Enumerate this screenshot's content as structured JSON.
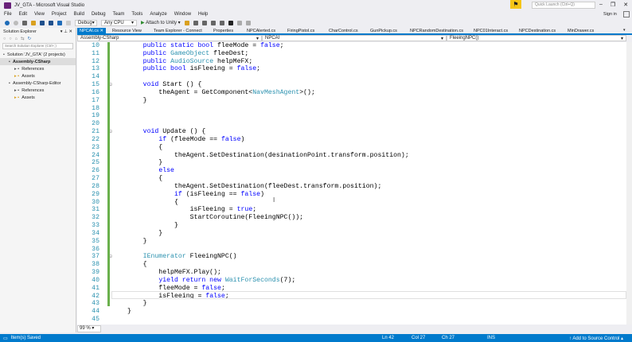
{
  "window": {
    "title": "JV_GTA - Microsoft Visual Studio",
    "quick_launch_placeholder": "Quick Launch (Ctrl+Q)",
    "sign_in": "Sign in"
  },
  "menu": [
    "File",
    "Edit",
    "View",
    "Project",
    "Build",
    "Debug",
    "Team",
    "Tools",
    "Analyze",
    "Window",
    "Help"
  ],
  "toolbar": {
    "config": "Debug",
    "platform": "Any CPU",
    "attach": "Attach to Unity"
  },
  "solution_explorer": {
    "title": "Solution Explorer",
    "search_placeholder": "Search Solution Explorer (Ctrl+;)",
    "items": [
      {
        "label": "Solution 'JV_GTA' (2 projects)",
        "indent": 0
      },
      {
        "label": "Assembly-CSharp",
        "indent": 1
      },
      {
        "label": "References",
        "indent": 2
      },
      {
        "label": "Assets",
        "indent": 2
      },
      {
        "label": "Assembly-CSharp-Editor",
        "indent": 1
      },
      {
        "label": "References",
        "indent": 2
      },
      {
        "label": "Assets",
        "indent": 2
      }
    ]
  },
  "tabs": [
    "NPCAI.cs",
    "Resource View",
    "Team Explorer - Connect",
    "Properties",
    "NPCAlerted.cs",
    "FiringPistol.cs",
    "CharControl.cs",
    "GunPickup.cs",
    "NPCRandomDestination.cs",
    "NPC01Interact.cs",
    "NPCDestination.cs",
    "MinDrawer.cs"
  ],
  "navbar": {
    "project": "Assembly-CSharp",
    "class": "NPCAI",
    "member": "FleeingNPC()"
  },
  "code": [
    {
      "n": "10",
      "t": [
        [
          "    ",
          "pl"
        ],
        [
          "public static bool ",
          "kw"
        ],
        [
          "fleeMode = ",
          "pl"
        ],
        [
          "false",
          "kw"
        ],
        [
          ";",
          "pl"
        ]
      ]
    },
    {
      "n": "11",
      "t": [
        [
          "    ",
          "pl"
        ],
        [
          "public ",
          "kw"
        ],
        [
          "GameObject ",
          "ty"
        ],
        [
          "fleeDest;",
          "pl"
        ]
      ]
    },
    {
      "n": "12",
      "t": [
        [
          "    ",
          "pl"
        ],
        [
          "public ",
          "kw"
        ],
        [
          "AudioSource ",
          "ty"
        ],
        [
          "helpMeFX;",
          "pl"
        ]
      ]
    },
    {
      "n": "13",
      "t": [
        [
          "    ",
          "pl"
        ],
        [
          "public bool ",
          "kw"
        ],
        [
          "isFleeing = ",
          "pl"
        ],
        [
          "false",
          "kw"
        ],
        [
          ";",
          "pl"
        ]
      ]
    },
    {
      "n": "14",
      "t": []
    },
    {
      "n": "15",
      "t": [
        [
          "    ",
          "pl"
        ],
        [
          "void ",
          "kw"
        ],
        [
          "Start () {",
          "pl"
        ]
      ]
    },
    {
      "n": "16",
      "t": [
        [
          "        theAgent = GetComponent<",
          "pl"
        ],
        [
          "NavMeshAgent",
          "ty"
        ],
        [
          ">();",
          "pl"
        ]
      ]
    },
    {
      "n": "17",
      "t": [
        [
          "    }",
          "pl"
        ]
      ]
    },
    {
      "n": "18",
      "t": []
    },
    {
      "n": "19",
      "t": []
    },
    {
      "n": "20",
      "t": []
    },
    {
      "n": "21",
      "t": [
        [
          "    ",
          "pl"
        ],
        [
          "void ",
          "kw"
        ],
        [
          "Update () {",
          "pl"
        ]
      ]
    },
    {
      "n": "22",
      "t": [
        [
          "        ",
          "pl"
        ],
        [
          "if ",
          "kw"
        ],
        [
          "(fleeMode == ",
          "pl"
        ],
        [
          "false",
          "kw"
        ],
        [
          ")",
          "pl"
        ]
      ]
    },
    {
      "n": "23",
      "t": [
        [
          "        {",
          "pl"
        ]
      ]
    },
    {
      "n": "24",
      "t": [
        [
          "            theAgent.SetDestination(desinationPoint.transform.position);",
          "pl"
        ]
      ]
    },
    {
      "n": "25",
      "t": [
        [
          "        }",
          "pl"
        ]
      ]
    },
    {
      "n": "26",
      "t": [
        [
          "        ",
          "pl"
        ],
        [
          "else",
          "kw"
        ]
      ]
    },
    {
      "n": "27",
      "t": [
        [
          "        {",
          "pl"
        ]
      ]
    },
    {
      "n": "28",
      "t": [
        [
          "            theAgent.SetDestination(fleeDest.transform.position);",
          "pl"
        ]
      ]
    },
    {
      "n": "29",
      "t": [
        [
          "            ",
          "pl"
        ],
        [
          "if ",
          "kw"
        ],
        [
          "(isFleeing == ",
          "pl"
        ],
        [
          "false",
          "kw"
        ],
        [
          ")",
          "pl"
        ]
      ]
    },
    {
      "n": "30",
      "t": [
        [
          "            {",
          "pl"
        ]
      ]
    },
    {
      "n": "31",
      "t": [
        [
          "                isFleeing = ",
          "pl"
        ],
        [
          "true",
          "kw"
        ],
        [
          ";",
          "pl"
        ]
      ]
    },
    {
      "n": "32",
      "t": [
        [
          "                StartCoroutine(FleeingNPC());",
          "pl"
        ]
      ]
    },
    {
      "n": "33",
      "t": [
        [
          "            }",
          "pl"
        ]
      ]
    },
    {
      "n": "34",
      "t": [
        [
          "        }",
          "pl"
        ]
      ]
    },
    {
      "n": "35",
      "t": [
        [
          "    }",
          "pl"
        ]
      ]
    },
    {
      "n": "36",
      "t": []
    },
    {
      "n": "37",
      "t": [
        [
          "    ",
          "pl"
        ],
        [
          "IEnumerator ",
          "ty"
        ],
        [
          "FleeingNPC()",
          "pl"
        ]
      ]
    },
    {
      "n": "38",
      "t": [
        [
          "    {",
          "pl"
        ]
      ]
    },
    {
      "n": "39",
      "t": [
        [
          "        helpMeFX.Play();",
          "pl"
        ]
      ]
    },
    {
      "n": "40",
      "t": [
        [
          "        ",
          "pl"
        ],
        [
          "yield return new ",
          "kw"
        ],
        [
          "WaitForSeconds",
          "ty"
        ],
        [
          "(7);",
          "pl"
        ]
      ]
    },
    {
      "n": "41",
      "t": [
        [
          "        fleeMode = ",
          "pl"
        ],
        [
          "false",
          "kw"
        ],
        [
          ";",
          "pl"
        ]
      ]
    },
    {
      "n": "42",
      "t": [
        [
          "        isFleeing = ",
          "pl"
        ],
        [
          "false",
          "kw"
        ],
        [
          ";",
          "pl"
        ]
      ]
    },
    {
      "n": "43",
      "t": [
        [
          "    }",
          "pl"
        ]
      ]
    },
    {
      "n": "44",
      "t": [
        [
          "}",
          "pl"
        ]
      ]
    },
    {
      "n": "45",
      "t": []
    }
  ],
  "zoom": "99 %",
  "status": {
    "message": "Item(s) Saved",
    "ln": "Ln 42",
    "col": "Col 27",
    "ch": "Ch 27",
    "mode": "INS",
    "source_control": "Add to Source Control"
  }
}
